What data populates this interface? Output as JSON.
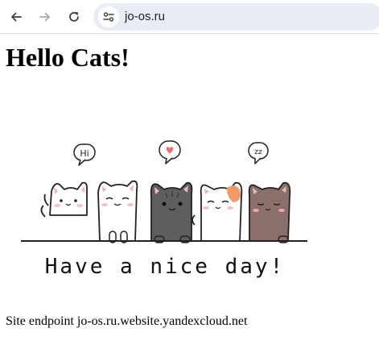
{
  "browser": {
    "url": "jo-os.ru",
    "icons": {
      "back": "arrow-left-icon",
      "forward": "arrow-right-icon",
      "reload": "reload-icon",
      "site_info": "tune-icon"
    }
  },
  "page": {
    "heading": "Hello Cats!",
    "image": {
      "bubbles": [
        "Hi",
        "♥",
        "zz"
      ],
      "caption": "Have a nice day!"
    },
    "endpoint_text": "Site endpoint jo-os.ru.website.yandexcloud.net"
  }
}
